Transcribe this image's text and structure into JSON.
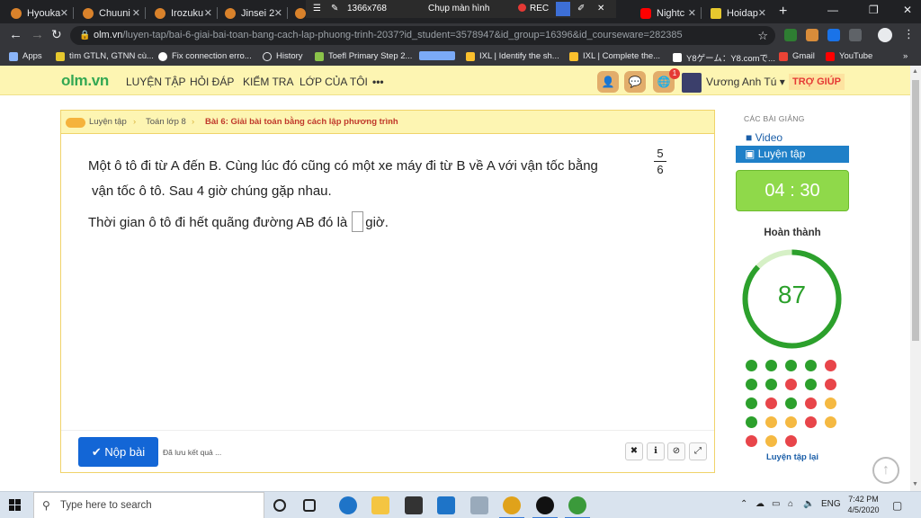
{
  "browser": {
    "tabs": [
      {
        "title": "Hyouka",
        "icon": "anime-site-icon"
      },
      {
        "title": "Chuuni",
        "icon": "anime-site-icon"
      },
      {
        "title": "Irozuku",
        "icon": "anime-site-icon"
      },
      {
        "title": "Jinsei 2",
        "icon": "anime-site-icon"
      },
      {
        "title": "Nightc",
        "icon": "youtube-icon"
      },
      {
        "title": "Hoidap",
        "icon": "hoidap-icon"
      }
    ],
    "recorder": {
      "resolution": "1366x768",
      "capture_label": "Chụp màn hình",
      "rec_label": "REC"
    },
    "url_host": "olm.vn",
    "url_path": "/luyen-tap/bai-6-giai-bai-toan-bang-cach-lap-phuong-trinh-2037?id_student=3578947&id_group=16396&id_courseware=282385",
    "bookmarks": [
      "Apps",
      "tìm GTLN, GTNN cù...",
      "Fix connection erro...",
      "History",
      "Toefl Primary Step 2...",
      "IXL | Identify the sh...",
      "IXL | Complete the...",
      "Y8ゲーム：Y8.comで...",
      "Gmail",
      "YouTube"
    ]
  },
  "site": {
    "logo": "olm.vn",
    "nav": [
      "LUYỆN TẬP",
      "HỎI ĐÁP",
      "KIỂM TRA",
      "LỚP CỦA TÔI",
      "•••"
    ],
    "notification_count": "1",
    "user_name": "Vương Anh Tú",
    "help_label": "TRỢ GIÚP"
  },
  "breadcrumb": [
    "Luyện tập",
    "Toán lớp 8",
    "Bài 6: Giải bài toán bằng cách lập phương trình"
  ],
  "question": {
    "line1": "Một ô tô đi từ A đến B. Cùng lúc đó cũng có một xe máy đi từ B về A với vận tốc bằng",
    "fraction_num": "5",
    "fraction_den": "6",
    "line2": "vận tốc ô tô. Sau 4 giờ chúng gặp nhau.",
    "line3_before": "Thời gian ô tô đi hết quãng đường AB đó là",
    "answer_value": "",
    "line3_after": "giờ."
  },
  "footer": {
    "submit_label": "✔ Nộp bài",
    "saved_text": "Đã lưu kết quả ..."
  },
  "sidebar": {
    "section_title": "CÁC BÀI GIẢNG",
    "video_label": "Video",
    "practice_label": "Luyện tập",
    "timer": "04 : 30",
    "done_label": "Hoàn thành",
    "score": "87",
    "progress_fraction": 0.87,
    "results": [
      "green",
      "green",
      "green",
      "green",
      "red",
      "green",
      "green",
      "red",
      "green",
      "red",
      "green",
      "red",
      "green",
      "red",
      "yellow",
      "green",
      "yellow",
      "yellow",
      "red",
      "yellow",
      "red",
      "yellow",
      "red"
    ],
    "retry_label": "Luyện tập lại"
  },
  "taskbar": {
    "search_placeholder": "Type here to search",
    "language": "ENG",
    "time": "7:42 PM",
    "date": "4/5/2020"
  },
  "colors": {
    "green": "#2ca02c",
    "red": "#e8454a",
    "yellow": "#f5b942",
    "header_bg": "#fdf5b2",
    "accent_blue": "#1366d6"
  }
}
